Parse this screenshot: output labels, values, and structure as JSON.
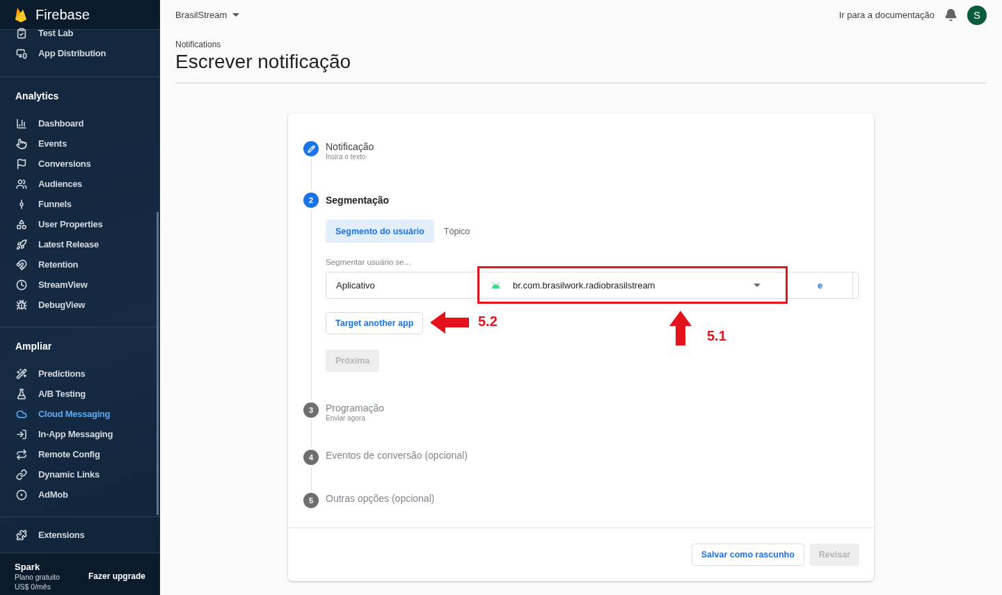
{
  "sidebar": {
    "brand": "Firebase",
    "sections": [
      {
        "items": [
          {
            "label": "Test Lab",
            "selected": false
          },
          {
            "label": "App Distribution",
            "selected": false
          }
        ]
      },
      {
        "title": "Analytics",
        "items": [
          {
            "label": "Dashboard",
            "selected": false
          },
          {
            "label": "Events",
            "selected": false
          },
          {
            "label": "Conversions",
            "selected": false
          },
          {
            "label": "Audiences",
            "selected": false
          },
          {
            "label": "Funnels",
            "selected": false
          },
          {
            "label": "User Properties",
            "selected": false
          },
          {
            "label": "Latest Release",
            "selected": false
          },
          {
            "label": "Retention",
            "selected": false
          },
          {
            "label": "StreamView",
            "selected": false
          },
          {
            "label": "DebugView",
            "selected": false
          }
        ]
      },
      {
        "title": "Ampliar",
        "items": [
          {
            "label": "Predictions",
            "selected": false
          },
          {
            "label": "A/B Testing",
            "selected": false
          },
          {
            "label": "Cloud Messaging",
            "selected": true
          },
          {
            "label": "In-App Messaging",
            "selected": false
          },
          {
            "label": "Remote Config",
            "selected": false
          },
          {
            "label": "Dynamic Links",
            "selected": false
          },
          {
            "label": "AdMob",
            "selected": false
          }
        ]
      },
      {
        "items": [
          {
            "label": "Extensions",
            "selected": false
          }
        ]
      }
    ],
    "plan": {
      "name": "Spark",
      "description": "Plano gratuito",
      "price": "US$ 0/mês",
      "upgrade": "Fazer upgrade"
    }
  },
  "topbar": {
    "project": "BrasilStream",
    "docs_link": "Ir para a documentação",
    "avatar": "S"
  },
  "header": {
    "breadcrumb": "Notifications",
    "title": "Escrever notificação"
  },
  "steps": [
    {
      "title": "Notificação",
      "subtitle": "Insira o texto",
      "completed": true,
      "active": false
    },
    {
      "number": "2",
      "title": "Segmentação",
      "completed": false,
      "active": true
    },
    {
      "number": "3",
      "title": "Programação",
      "subtitle": "Enviar agora",
      "completed": false,
      "active": false
    },
    {
      "number": "4",
      "title": "Eventos de conversão (opcional)",
      "completed": false,
      "active": false
    },
    {
      "number": "5",
      "title": "Outras opções (opcional)",
      "completed": false,
      "active": false
    }
  ],
  "targeting": {
    "tabs": [
      {
        "label": "Segmento do usuário",
        "selected": true
      },
      {
        "label": "Tópico",
        "selected": false
      }
    ],
    "field_label": "Segmentar usuário se...",
    "condition": "Aplicativo",
    "app": "br.com.brasilwork.radiobrasilstream",
    "and_link": "e",
    "target_button": "Target another app",
    "next_button": {
      "label": "Próxima",
      "disabled": true
    }
  },
  "annotations": [
    {
      "label": "5.1"
    },
    {
      "label": "5.2"
    }
  ],
  "footer": {
    "buttons": [
      {
        "label": "Salvar como rascunho",
        "disabled": false
      },
      {
        "label": "Revisar",
        "disabled": true
      }
    ]
  }
}
